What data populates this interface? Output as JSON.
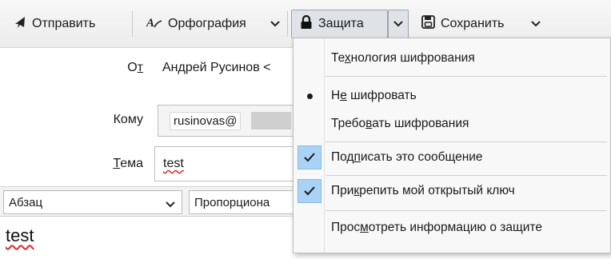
{
  "toolbar": {
    "send": {
      "label": "Отправить"
    },
    "spelling": {
      "label": "Орфография"
    },
    "security": {
      "label": "Защита"
    },
    "save": {
      "label": "Сохранить"
    }
  },
  "header": {
    "from": {
      "label_pre": "О",
      "label_u": "т",
      "value": "Андрей Русинов <"
    },
    "to": {
      "label": "Кому",
      "value": "rusinovas@"
    },
    "subject": {
      "label_pre": "",
      "label_u": "Т",
      "label_post": "ема",
      "value": "test"
    }
  },
  "format": {
    "paragraph": "Абзац",
    "font": "Пропорциона"
  },
  "body": {
    "text": "test"
  },
  "security_menu": {
    "items": [
      {
        "pre": "Те",
        "u": "х",
        "post": "нология шифрования",
        "mark": "none"
      },
      {
        "pre": "Н",
        "u": "е",
        "post": " шифровать",
        "mark": "dot"
      },
      {
        "pre": "Требо",
        "u": "в",
        "post": "ать шифрования",
        "mark": "none"
      },
      {
        "pre": "Под",
        "u": "п",
        "post": "исать это сообщение",
        "mark": "check"
      },
      {
        "pre": "При",
        "u": "к",
        "post": "репить мой открытый ключ",
        "mark": "check"
      },
      {
        "pre": "Прос",
        "u": "м",
        "post": "отреть информацию о защите",
        "mark": "none"
      }
    ]
  },
  "colors": {
    "check_highlight": "#a9d2f5",
    "spell_error": "#dd3333"
  }
}
